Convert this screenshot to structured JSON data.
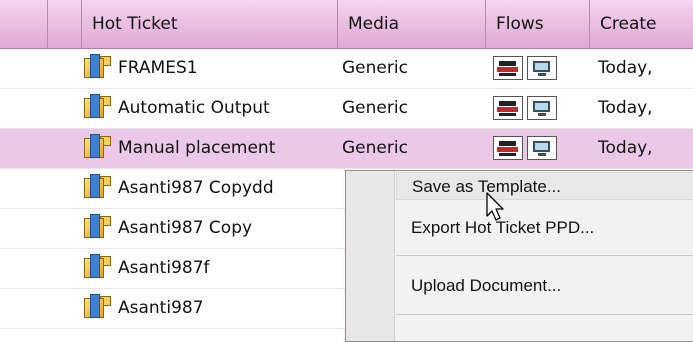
{
  "columns": {
    "name": "Hot Ticket",
    "media": "Media",
    "flows": "Flows",
    "created": "Create"
  },
  "rows": [
    {
      "name": "FRAMES1",
      "media": "Generic",
      "created": "Today,"
    },
    {
      "name": "Automatic Output",
      "media": "Generic",
      "created": "Today,"
    },
    {
      "name": "Manual placement",
      "media": "Generic",
      "created": "Today,"
    },
    {
      "name": "Asanti987 Copydd",
      "media": "",
      "created": ""
    },
    {
      "name": "Asanti987 Copy",
      "media": "",
      "created": ""
    },
    {
      "name": "Asanti987f",
      "media": "",
      "created": ""
    },
    {
      "name": "Asanti987",
      "media": "",
      "created": ""
    }
  ],
  "context_menu": {
    "items": [
      "Save as Template...",
      "Export Hot Ticket PPD...",
      "Upload Document..."
    ]
  },
  "colors": {
    "header_bg": "#e0a8d6",
    "selected_row_bg": "#ecc8e8",
    "menu_bg": "#f2f2f2"
  },
  "icons": {
    "ticket": "hot-ticket-icon",
    "flow_print": "printer-icon",
    "flow_preview": "monitor-icon"
  }
}
